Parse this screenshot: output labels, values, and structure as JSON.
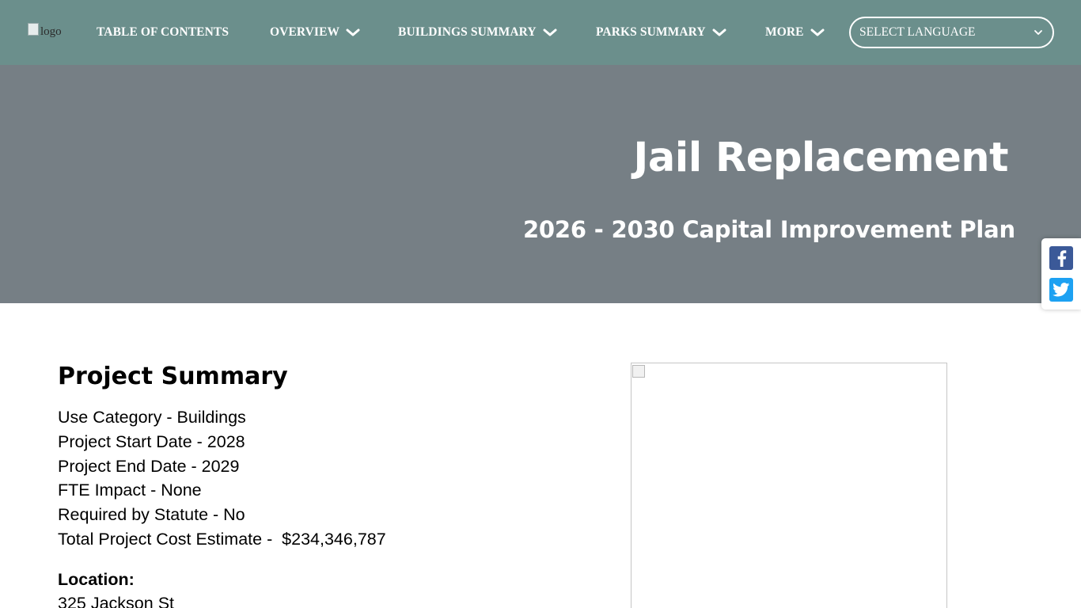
{
  "nav": {
    "logo_alt": "logo",
    "items": [
      {
        "label": "TABLE OF CONTENTS",
        "has_dropdown": false
      },
      {
        "label": "OVERVIEW",
        "has_dropdown": true
      },
      {
        "label": "BUILDINGS SUMMARY",
        "has_dropdown": true
      },
      {
        "label": "PARKS SUMMARY",
        "has_dropdown": true
      },
      {
        "label": "MORE",
        "has_dropdown": true
      }
    ],
    "language_select": {
      "value": "SELECT LANGUAGE"
    }
  },
  "hero": {
    "title": "Jail Replacement",
    "subtitle": "2026 - 2030 Capital Improvement Plan"
  },
  "share": {
    "buttons": [
      {
        "icon": "facebook-icon",
        "color": "#3b5998"
      },
      {
        "icon": "twitter-icon",
        "color": "#1da1f2"
      }
    ]
  },
  "summary": {
    "title": "Project Summary",
    "lines": [
      "Use Category - Buildings",
      "Project Start Date - 2028",
      "Project End Date - 2029",
      "FTE Impact - None",
      "Required by Statute - No",
      "Total Project Cost Estimate -  $234,346,787"
    ],
    "location_label": "Location:",
    "location_address": "325 Jackson St"
  },
  "colors": {
    "nav_bg": "#6b8f8c",
    "hero_bg": "#767f85",
    "text": "#000000"
  }
}
